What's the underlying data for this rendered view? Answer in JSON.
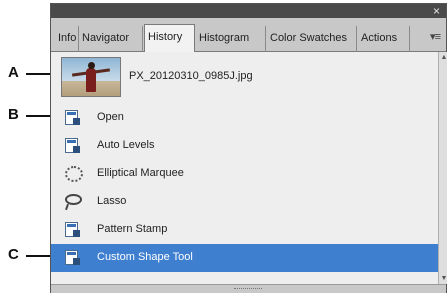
{
  "callouts": {
    "a": "A",
    "b": "B",
    "c": "C"
  },
  "panel": {
    "close_glyph": "×",
    "menu_glyph": "▾≡",
    "tabs": [
      {
        "label": "Info",
        "active": false
      },
      {
        "label": "Navigator",
        "active": false
      },
      {
        "label": "History",
        "active": true
      },
      {
        "label": "Histogram",
        "active": false
      },
      {
        "label": "Color Swatches",
        "active": false
      },
      {
        "label": "Actions",
        "active": false
      }
    ]
  },
  "snapshot": {
    "filename": "PX_20120310_0985J.jpg"
  },
  "history": [
    {
      "label": "Open",
      "icon": "document-icon",
      "selected": false
    },
    {
      "label": "Auto Levels",
      "icon": "document-icon",
      "selected": false
    },
    {
      "label": "Elliptical Marquee",
      "icon": "elliptical-marquee-icon",
      "selected": false
    },
    {
      "label": "Lasso",
      "icon": "lasso-icon",
      "selected": false
    },
    {
      "label": "Pattern Stamp",
      "icon": "document-icon",
      "selected": false
    },
    {
      "label": "Custom Shape Tool",
      "icon": "document-icon",
      "selected": true
    }
  ],
  "colors": {
    "selection": "#3f7fd0",
    "titlebar": "#4a4a4a"
  }
}
